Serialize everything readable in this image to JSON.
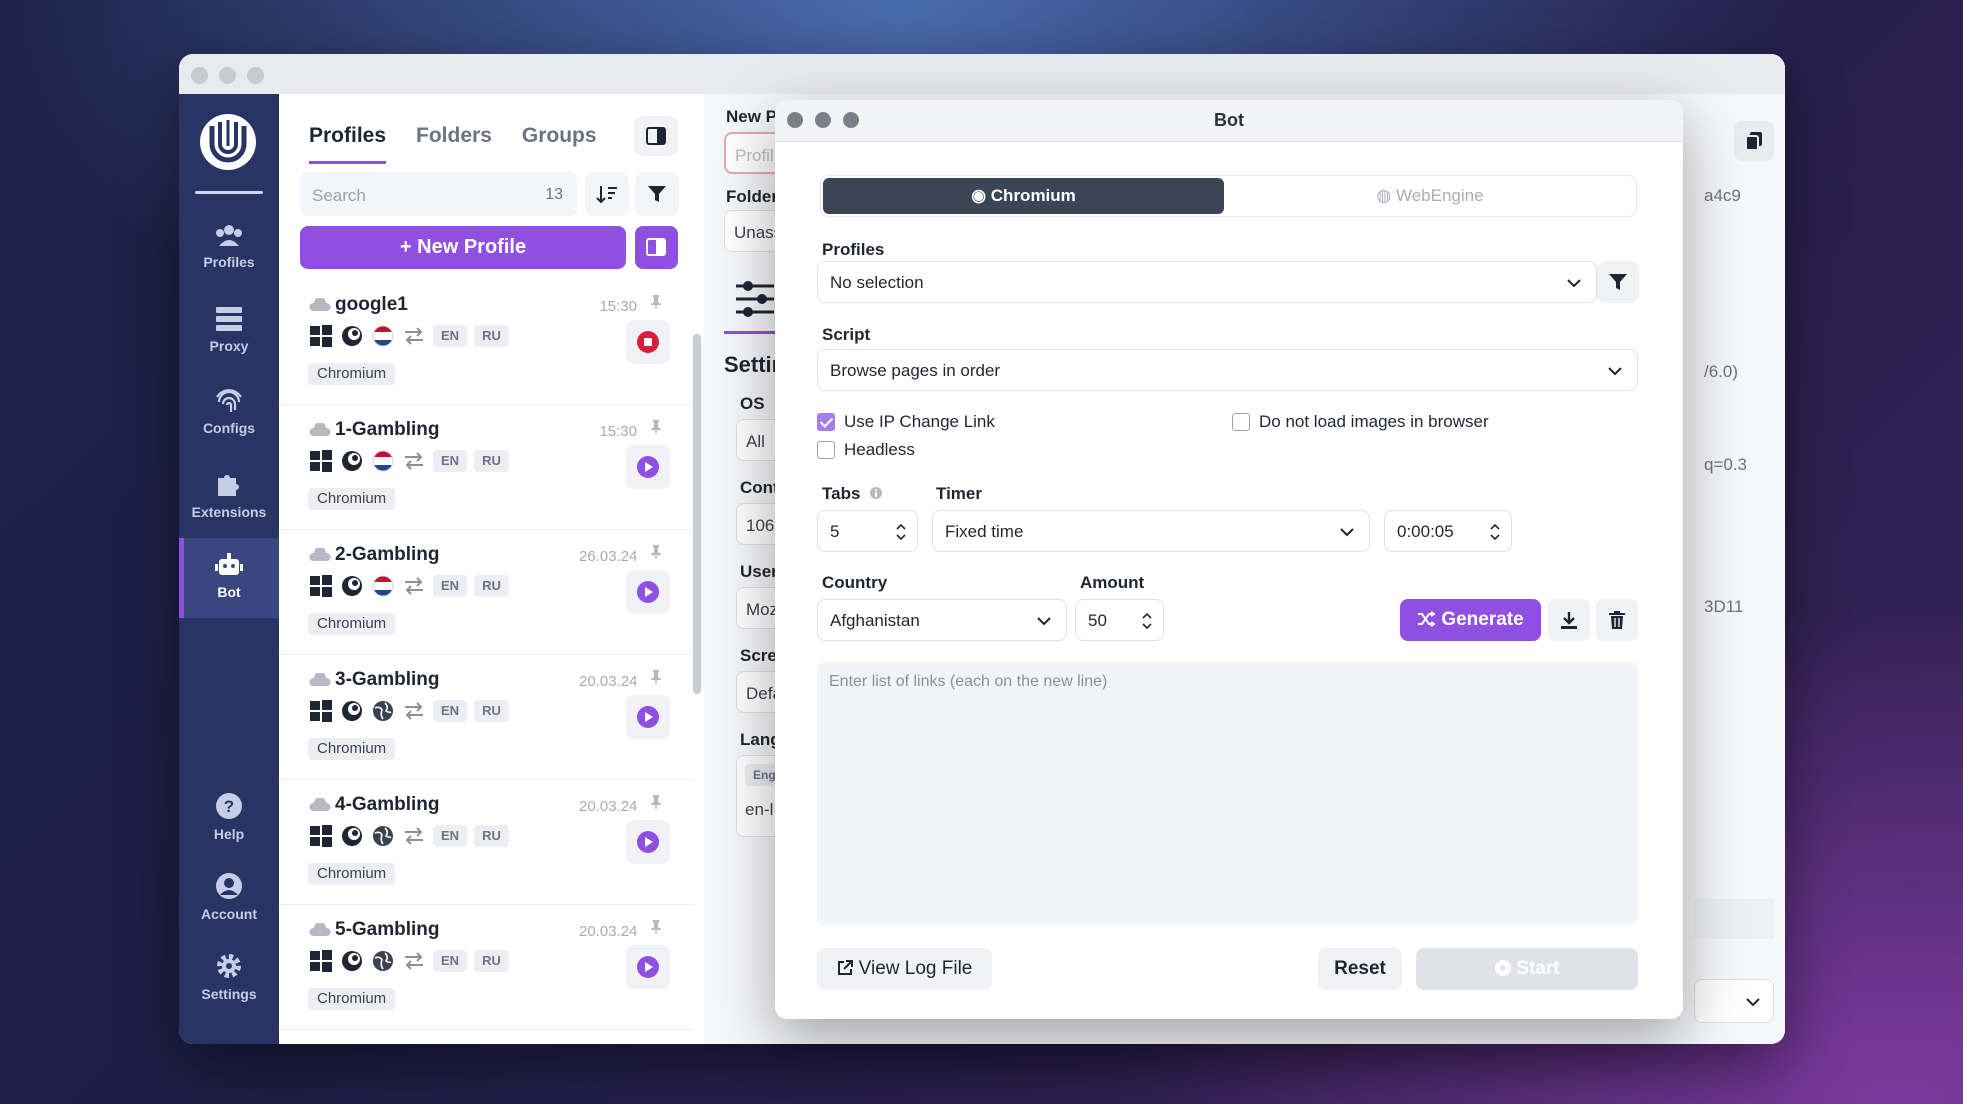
{
  "app": {
    "accent": "#8f4fe0",
    "rail_color": "#283463"
  },
  "rail": {
    "items": [
      {
        "label": "Profiles",
        "icon": "profiles-icon"
      },
      {
        "label": "Proxy",
        "icon": "proxy-icon"
      },
      {
        "label": "Configs",
        "icon": "fingerprint-icon"
      },
      {
        "label": "Extensions",
        "icon": "puzzle-icon"
      },
      {
        "label": "Bot",
        "icon": "robot-icon"
      },
      {
        "label": "Help",
        "icon": "help-icon"
      },
      {
        "label": "Account",
        "icon": "account-icon"
      },
      {
        "label": "Settings",
        "icon": "gear-icon"
      }
    ],
    "active": "Bot"
  },
  "profiles": {
    "tabs": [
      "Profiles",
      "Folders",
      "Groups"
    ],
    "active_tab": "Profiles",
    "search_placeholder": "Search",
    "count": "13",
    "new_button": "New Profile",
    "rows": [
      {
        "name": "google1",
        "date": "15:30",
        "flag": "netherlands",
        "lang1": "EN",
        "lang2": "RU",
        "engine": "Chromium",
        "state": "running"
      },
      {
        "name": "1-Gambling",
        "date": "15:30",
        "flag": "netherlands",
        "lang1": "EN",
        "lang2": "RU",
        "engine": "Chromium",
        "state": "stopped"
      },
      {
        "name": "2-Gambling",
        "date": "26.03.24",
        "flag": "netherlands",
        "lang1": "EN",
        "lang2": "RU",
        "engine": "Chromium",
        "state": "stopped"
      },
      {
        "name": "3-Gambling",
        "date": "20.03.24",
        "flag": "globe",
        "lang1": "EN",
        "lang2": "RU",
        "engine": "Chromium",
        "state": "stopped"
      },
      {
        "name": "4-Gambling",
        "date": "20.03.24",
        "flag": "globe",
        "lang1": "EN",
        "lang2": "RU",
        "engine": "Chromium",
        "state": "stopped"
      },
      {
        "name": "5-Gambling",
        "date": "20.03.24",
        "flag": "globe",
        "lang1": "EN",
        "lang2": "RU",
        "engine": "Chromium",
        "state": "stopped"
      }
    ]
  },
  "editor": {
    "new_label": "New P",
    "profile_placeholder": "Profil",
    "folder_label": "Folder",
    "folder_value": "Unass",
    "settings_label": "Settin",
    "os_label": "OS",
    "os_value": "All",
    "cont_label": "Cont",
    "cont_value": "106",
    "user_label": "User",
    "user_value": "Moz",
    "screen_label": "Scre",
    "screen_value": "Defa",
    "lang_label": "Lang",
    "lang_chip": "Eng",
    "lang_value": "en-l",
    "right_a4c9": "a4c9",
    "right_60": "/6.0)",
    "right_q": "q=0.3",
    "right_3d11": "3D11"
  },
  "bot": {
    "title": "Bot",
    "engines": [
      "Chromium",
      "WebEngine"
    ],
    "active_engine": "Chromium",
    "profiles_label": "Profiles",
    "profiles_value": "No selection",
    "script_label": "Script",
    "script_value": "Browse pages in order",
    "opt_ip_change": "Use IP Change Link",
    "opt_ip_change_checked": true,
    "opt_no_images": "Do not load images in browser",
    "opt_no_images_checked": false,
    "opt_headless": "Headless",
    "opt_headless_checked": false,
    "tabs_label": "Tabs",
    "tabs_value": "5",
    "timer_label": "Timer",
    "timer_mode": "Fixed time",
    "timer_value": "0:00:05",
    "country_label": "Country",
    "country_value": "Afghanistan",
    "amount_label": "Amount",
    "amount_value": "50",
    "generate_label": "Generate",
    "links_placeholder": "Enter list of links (each on the new line)",
    "view_log": "View Log File",
    "reset": "Reset",
    "start": "Start"
  }
}
